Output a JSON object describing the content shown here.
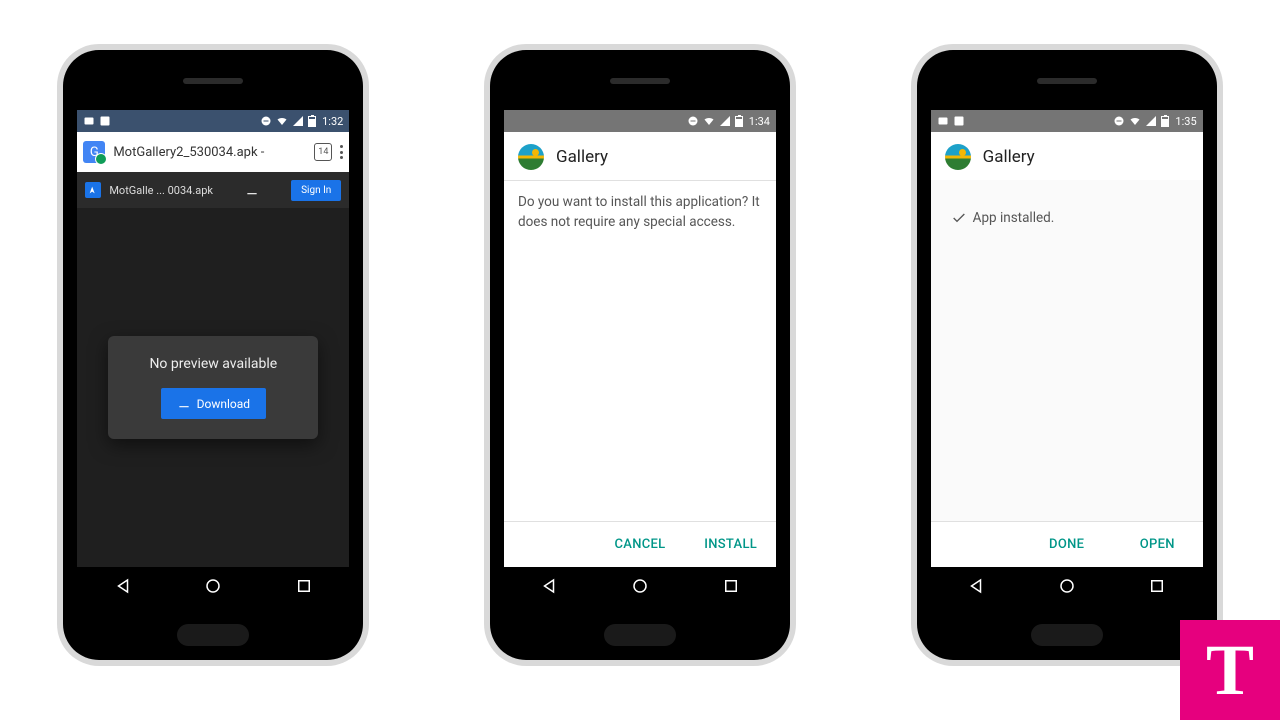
{
  "phone1": {
    "status": {
      "time": "1:32"
    },
    "address_bar": {
      "text": "MotGallery2_530034.apk -",
      "tab_count": "14"
    },
    "drive_bar": {
      "filename": "MotGalle ... 0034.apk",
      "signin": "Sign In"
    },
    "preview": {
      "message": "No preview available",
      "download_label": "Download"
    }
  },
  "phone2": {
    "status": {
      "time": "1:34"
    },
    "app_title": "Gallery",
    "prompt": "Do you want to install this application? It does not require any special access.",
    "cancel": "CANCEL",
    "install": "INSTALL"
  },
  "phone3": {
    "status": {
      "time": "1:35"
    },
    "app_title": "Gallery",
    "installed_msg": "App installed.",
    "done": "DONE",
    "open": "OPEN"
  },
  "badge": {
    "letter": "T"
  }
}
